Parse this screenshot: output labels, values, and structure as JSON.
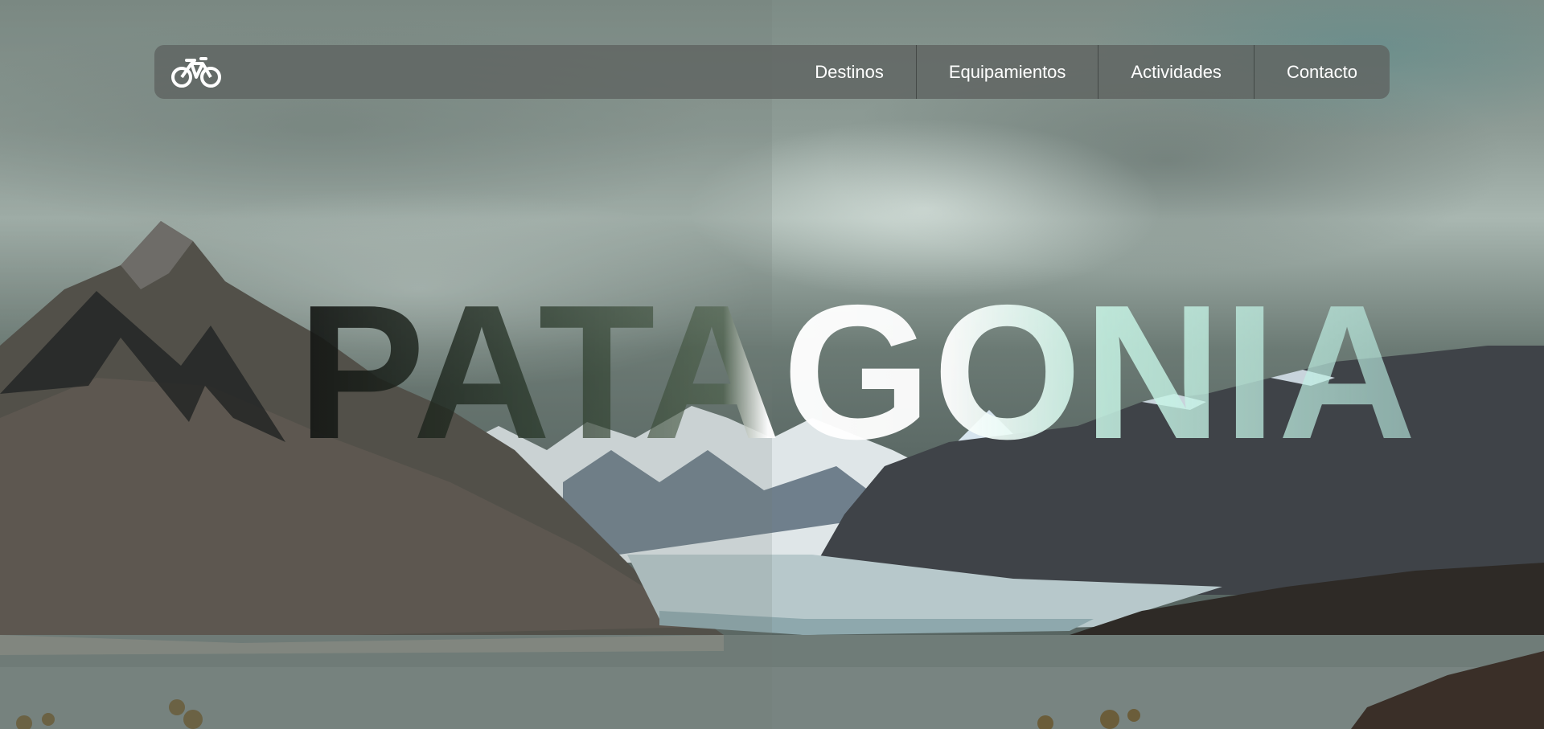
{
  "app": {
    "hero_title": "PATAGONIA"
  },
  "navbar": {
    "logo_icon": "bicycle-icon",
    "items": [
      {
        "label": "Destinos"
      },
      {
        "label": "Equipamientos"
      },
      {
        "label": "Actividades"
      },
      {
        "label": "Contacto"
      }
    ]
  },
  "colors": {
    "navbar_bg": "#5f6462",
    "nav_text": "#ffffff",
    "title_dark": "#141614",
    "title_light": "#ffffff",
    "title_mint": "#b9ebe1"
  },
  "decorations": {
    "mountain_logo_icon": "mountain-peaks-icon",
    "background_image": "patagonia-glacier-landscape"
  }
}
